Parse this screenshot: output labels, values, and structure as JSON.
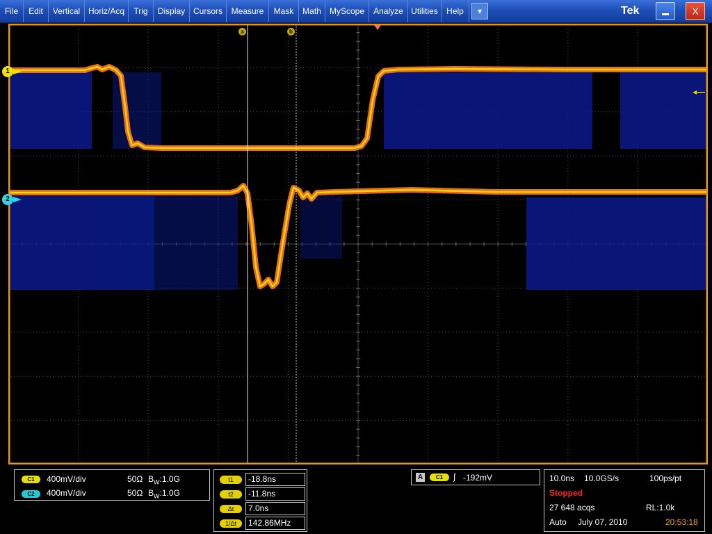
{
  "menu": {
    "items": [
      {
        "label": "File"
      },
      {
        "label": "Edit"
      },
      {
        "label": "Vertical"
      },
      {
        "label": "Horiz/Acq"
      },
      {
        "label": "Trig"
      },
      {
        "label": "Display"
      },
      {
        "label": "Cursors"
      },
      {
        "label": "Measure"
      },
      {
        "label": "Mask"
      },
      {
        "label": "Math"
      },
      {
        "label": "MyScope"
      },
      {
        "label": "Analyze"
      },
      {
        "label": "Utilities"
      },
      {
        "label": "Help"
      }
    ],
    "dropdown_glyph": "▾",
    "brand": "Tek",
    "close_glyph": "X"
  },
  "markers": {
    "ch1": "1",
    "ch2": "2",
    "cursor_a": "a",
    "cursor_b": "b"
  },
  "channels": [
    {
      "badge": "C1",
      "scale": "400mV/div",
      "impedance": "50Ω",
      "bw_prefix": "B",
      "bw_sub": "W",
      "bw_value": ":1.0G"
    },
    {
      "badge": "C2",
      "scale": "400mV/div",
      "impedance": "50Ω",
      "bw_prefix": "B",
      "bw_sub": "W",
      "bw_value": ":1.0G"
    }
  ],
  "cursor_readout": [
    {
      "label": "t1",
      "value": "-18.8ns"
    },
    {
      "label": "t2",
      "value": "-11.8ns"
    },
    {
      "label": "Δt",
      "value": "7.0ns"
    },
    {
      "label": "1/Δt",
      "value": "142.86MHz"
    }
  ],
  "trigger": {
    "mode_badge": "A",
    "source": "C1",
    "slope_glyph": "∫",
    "level": "-192mV"
  },
  "acquisition": {
    "timebase": "10.0ns",
    "sample_rate": "10.0GS/s",
    "resolution": "100ps/pt",
    "state": "Stopped",
    "acq_count": "27 648 acqs",
    "record_length": "RL:1.0k",
    "mode": "Auto",
    "date": "July 07, 2010",
    "time": "20:53:18"
  },
  "colors": {
    "graticule_border": "#e8931c",
    "grid": "#4a4a4a",
    "persistence": "#0a1a8c",
    "ch1_marker": "#f0e400",
    "ch2_marker": "#2fd6e6",
    "stopped": "#ff2020",
    "clock": "#f0a020"
  }
}
